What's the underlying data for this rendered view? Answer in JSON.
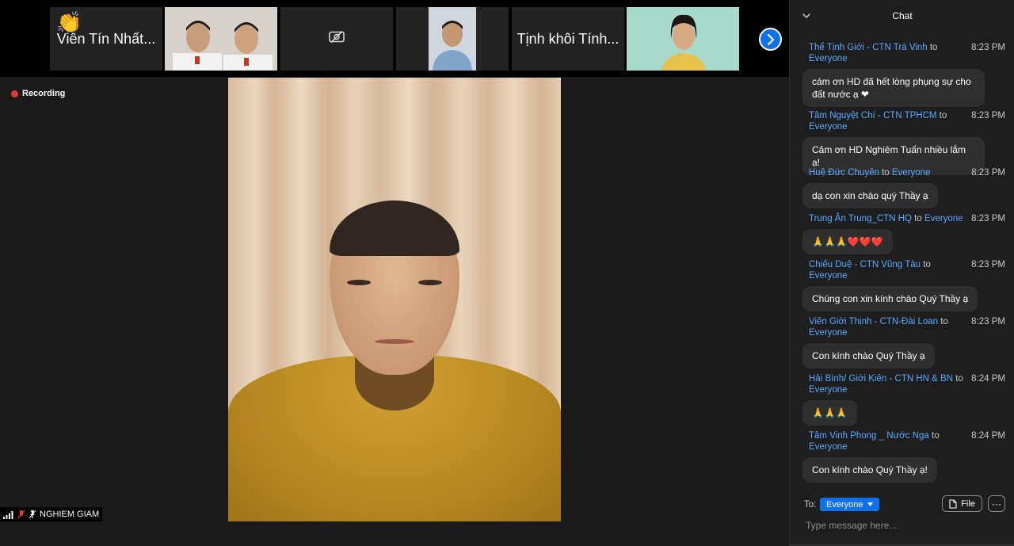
{
  "colors": {
    "accent": "#0e71eb",
    "sender": "#5aa9ff",
    "recording": "#e53935"
  },
  "thumbnails": [
    {
      "type": "name",
      "name": "Viên Tín Nhất...",
      "reaction": "👏"
    },
    {
      "type": "video",
      "description": "two-people-video"
    },
    {
      "type": "camera-off",
      "icon": "video-off-icon"
    },
    {
      "type": "video",
      "description": "person-video"
    },
    {
      "type": "name",
      "name": "Tịnh khôi Tính..."
    },
    {
      "type": "video",
      "description": "person-video"
    }
  ],
  "recording_label": "Recording",
  "main_speaker": {
    "name": "NGHIEM GIAM"
  },
  "chat": {
    "title": "Chat",
    "messages": [
      {
        "sender": "Thể Tịnh Giới - CTN Trà Vinh",
        "to_word": "to",
        "recipient": "Everyone",
        "time": "8:23 PM",
        "text": "cám ơn HD đã hết lòng phụng sự cho đất nước ạ ❤"
      },
      {
        "sender": "Tâm Nguyệt Chí - CTN TPHCM",
        "to_word": "to",
        "recipient": "Everyone",
        "time": "8:23 PM",
        "text": "Cảm ơn HD Nghiêm Tuấn nhiều lắm ạ!"
      },
      {
        "sender": "Huệ Đức Chuyên",
        "to_word": "to",
        "recipient": "Everyone",
        "time": "8:23 PM",
        "text": "dạ con xin chào quý Thầy ạ"
      },
      {
        "sender": "Trung Ân Trung_CTN HQ",
        "to_word": "to",
        "recipient": "Everyone",
        "time": "8:23 PM",
        "text": "🙏🙏🙏❤️❤️❤️"
      },
      {
        "sender": "Chiếu Duệ - CTN Vũng Tàu",
        "to_word": "to",
        "recipient": "Everyone",
        "time": "8:23 PM",
        "text": "Chúng con xin kính chào Quý Thầy ạ"
      },
      {
        "sender": "Viên Giới  Thịnh - CTN-Đài Loan",
        "to_word": "to",
        "recipient": "Everyone",
        "time": "8:23 PM",
        "text": "Con kính chào Quý Thầy ạ"
      },
      {
        "sender": "Hải Bình/ Giới Kiên - CTN HN & BN",
        "to_word": "to",
        "recipient": "Everyone",
        "time": "8:24 PM",
        "text": "🙏🙏🙏"
      },
      {
        "sender": "Tâm Vinh Phong _ Nước Nga",
        "to_word": "to",
        "recipient": "Everyone",
        "time": "8:24 PM",
        "text": "Con kính chào Quý Thầy ạ!"
      }
    ],
    "composer": {
      "to_label": "To:",
      "recipient": "Everyone",
      "file_label": "File",
      "more_label": "···",
      "placeholder": "Type message here..."
    }
  }
}
